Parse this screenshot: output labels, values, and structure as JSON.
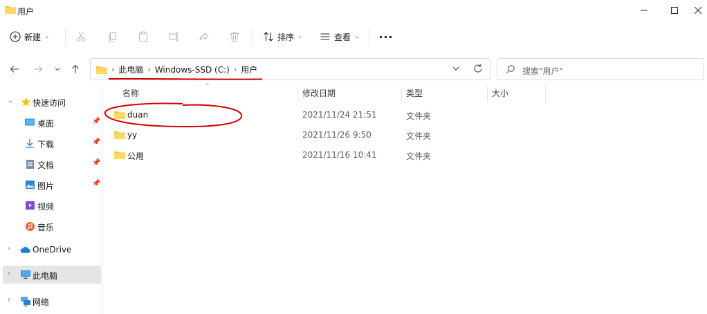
{
  "window": {
    "title": "用户"
  },
  "toolbar": {
    "new_label": "新建",
    "sort_label": "排序",
    "view_label": "查看",
    "more_label": "···"
  },
  "address": {
    "crumbs": [
      "此电脑",
      "Windows-SSD (C:)",
      "用户"
    ]
  },
  "search": {
    "placeholder": "搜索\"用户\""
  },
  "nav_pane": {
    "quick_access": "快速访问",
    "items": [
      {
        "label": "桌面",
        "icon": "desktop-icon"
      },
      {
        "label": "下载",
        "icon": "download-icon"
      },
      {
        "label": "文档",
        "icon": "document-icon"
      },
      {
        "label": "图片",
        "icon": "picture-icon"
      },
      {
        "label": "视频",
        "icon": "video-icon"
      },
      {
        "label": "音乐",
        "icon": "music-icon"
      }
    ],
    "onedrive": "OneDrive",
    "this_pc": "此电脑",
    "network": "网络"
  },
  "columns": {
    "name": "名称",
    "modified": "修改日期",
    "type": "类型",
    "size": "大小"
  },
  "files": [
    {
      "name": "duan",
      "modified": "2021/11/24 21:51",
      "type": "文件夹"
    },
    {
      "name": "yy",
      "modified": "2021/11/26 9:50",
      "type": "文件夹"
    },
    {
      "name": "公用",
      "modified": "2021/11/16 10:41",
      "type": "文件夹"
    }
  ],
  "colors": {
    "folder": "#f5c242",
    "selection": "#e5e5e5",
    "annotation_red": "#d40000"
  }
}
